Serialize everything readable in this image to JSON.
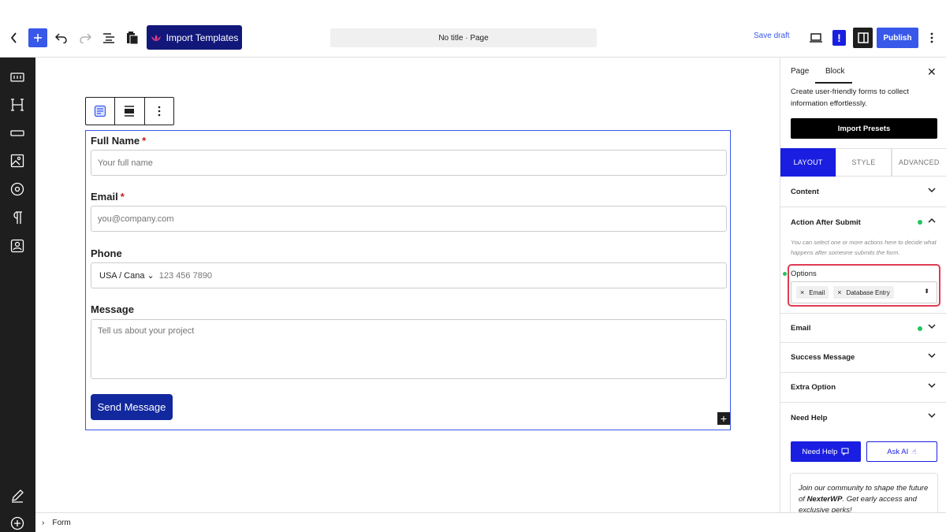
{
  "topbar": {
    "import_templates_label": "Import Templates",
    "doc_title": "No title · Page",
    "save_draft_label": "Save draft",
    "warning_label": "!",
    "publish_label": "Publish"
  },
  "toolbar_icons": [
    "back-chevron-icon",
    "add-block-icon",
    "undo-icon",
    "redo-icon",
    "document-overview-icon",
    "clipboard-icon",
    "view-icon",
    "sidebar-toggle-icon",
    "more-options-icon"
  ],
  "form": {
    "fields": [
      {
        "label": "Full Name",
        "required_mark": "*",
        "placeholder": "Your full name"
      },
      {
        "label": "Email",
        "required_mark": "*",
        "placeholder": "you@company.com"
      },
      {
        "label": "Phone",
        "country": "USA / Cana",
        "placeholder": "123 456 7890"
      },
      {
        "label": "Message",
        "placeholder": "Tell us about your project"
      }
    ],
    "submit_label": "Send Message"
  },
  "footer": {
    "breadcrumb": "Form"
  },
  "panel": {
    "tabs": [
      "Page",
      "Block"
    ],
    "active_tab": "Block",
    "description": "Create user-friendly forms to collect information effortlessly.",
    "import_presets_label": "Import Presets",
    "seg_tabs": [
      "LAYOUT",
      "STYLE",
      "ADVANCED"
    ],
    "sections": {
      "content": "Content",
      "action_after_submit": "Action After Submit",
      "action_desc": "You can select one or more actions here to decide what happens after someone submits the form.",
      "options_label": "Options",
      "options_chips": [
        "Email",
        "Database Entry"
      ],
      "email": "Email",
      "success_message": "Success Message",
      "extra_option": "Extra Option",
      "need_help": "Need Help"
    },
    "help_button_label": "Need Help",
    "ask_ai_label": "Ask AI",
    "community_pre": "Join our community to shape the future of ",
    "community_brand": "NexterWP",
    "community_post": ". Get early access and exclusive perks!"
  },
  "colors": {
    "accent": "#3858e9",
    "brand_dark": "#12187a",
    "panel_accent": "#1a1ee0",
    "highlight": "#e03b52",
    "status_dot": "#22c55e"
  }
}
